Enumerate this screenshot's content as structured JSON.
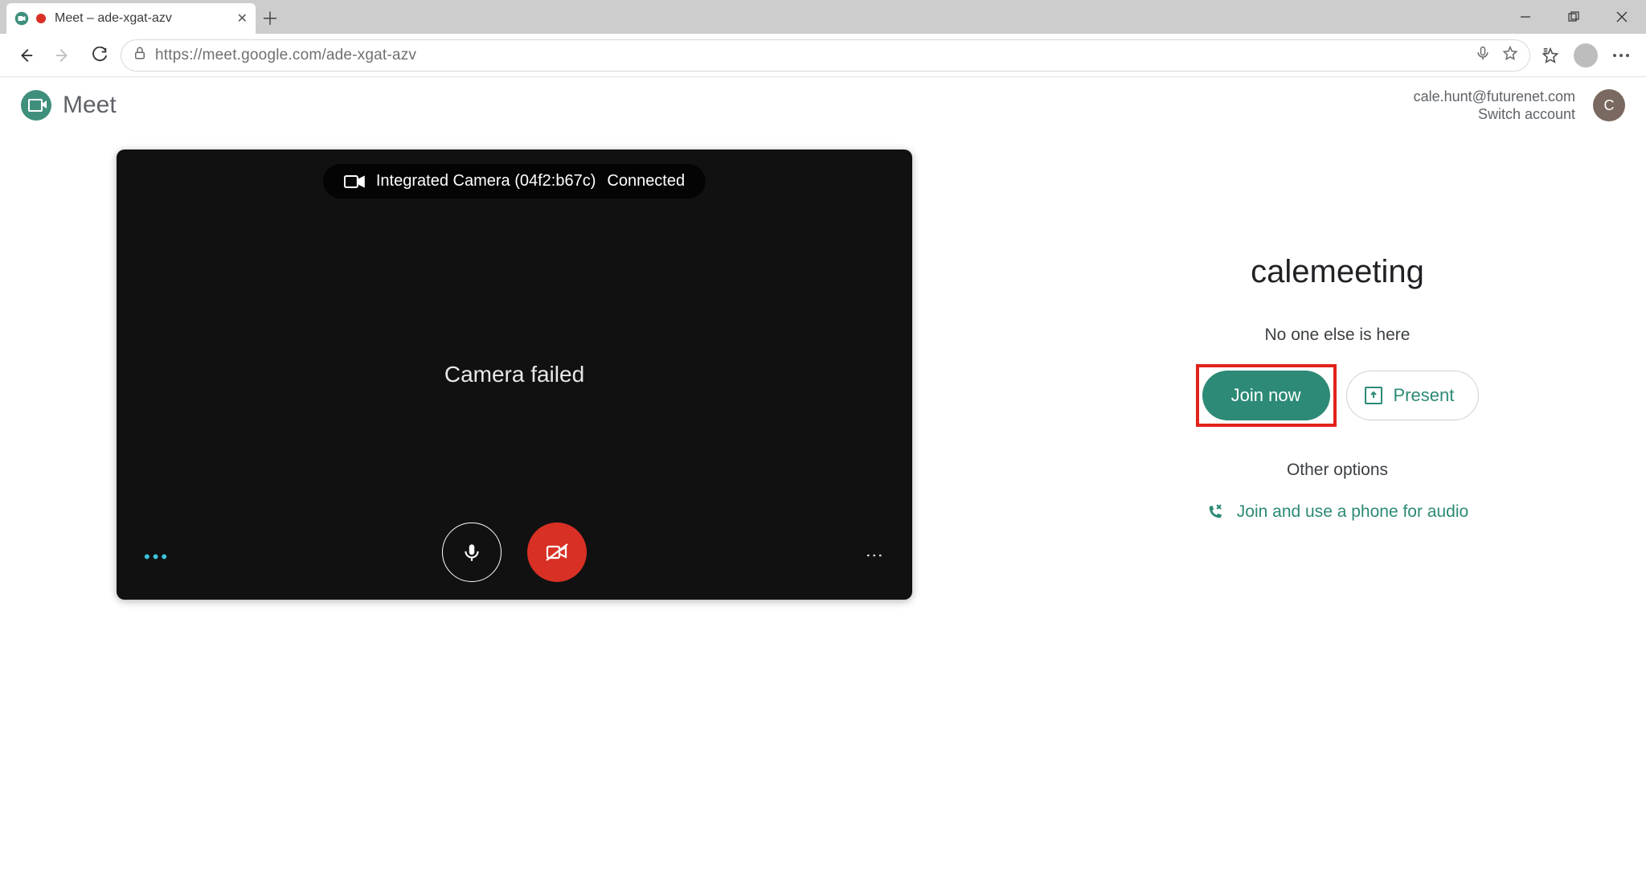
{
  "browser": {
    "tab_title": "Meet – ade-xgat-azv",
    "url": "https://meet.google.com/ade-xgat-azv"
  },
  "app": {
    "product_name": "Meet",
    "account_email": "cale.hunt@futurenet.com",
    "switch_account_label": "Switch account",
    "avatar_initial": "C"
  },
  "preview": {
    "camera_device": "Integrated Camera (04f2:b67c)",
    "camera_status": "Connected",
    "error_message": "Camera failed"
  },
  "join": {
    "meeting_name": "calemeeting",
    "alone_text": "No one else is here",
    "join_now_label": "Join now",
    "present_label": "Present",
    "other_options_label": "Other options",
    "phone_audio_label": "Join and use a phone for audio"
  }
}
